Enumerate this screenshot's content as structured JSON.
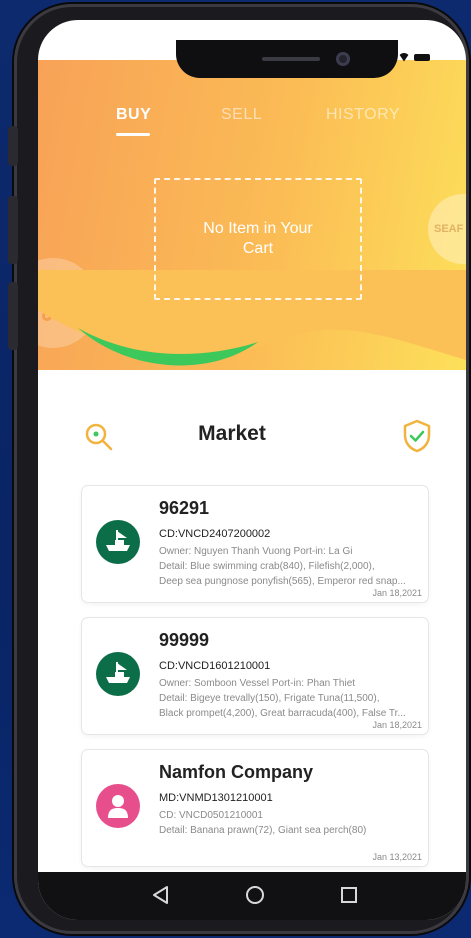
{
  "tabs": {
    "buy": "BUY",
    "sell": "SELL",
    "history": "HISTORY"
  },
  "cart": {
    "empty_message": "No Item in Your Cart"
  },
  "side_badge": "SEAF",
  "market": {
    "title": "Market"
  },
  "cards": [
    {
      "title": "96291",
      "code": "CD:VNCD2407200002",
      "owner_line": "Owner: Nguyen Thanh Vuong  Port-in: La Gi",
      "detail_line1": "Detail: Blue swimming crab(840), Filefish(2,000),",
      "detail_line2": "Deep sea pungnose ponyfish(565), Emperor red snap...",
      "date": "Jan 18,2021",
      "avatar": "vessel-icon"
    },
    {
      "title": "99999",
      "code": "CD:VNCD1601210001",
      "owner_line": "Owner: Somboon Vessel  Port-in: Phan Thiet",
      "detail_line1": "Detail: Bigeye trevally(150), Frigate Tuna(11,500),",
      "detail_line2": "Black prompet(4,200), Great barracuda(400), False Tr...",
      "date": "Jan 18,2021",
      "avatar": "vessel-icon"
    },
    {
      "title": "Namfon Company",
      "code": "MD:VNMD1301210001",
      "owner_line": "CD: VNCD0501210001",
      "detail_line1": "Detail: Banana prawn(72), Giant sea perch(80)",
      "detail_line2": "",
      "date": "Jan 13,2021",
      "avatar": "person-icon"
    }
  ],
  "colors": {
    "header_start": "#f8a257",
    "header_end": "#fde05a",
    "accent_green": "#3cc85a",
    "vessel_avatar": "#0c6e49",
    "person_avatar": "#e64f8c"
  }
}
